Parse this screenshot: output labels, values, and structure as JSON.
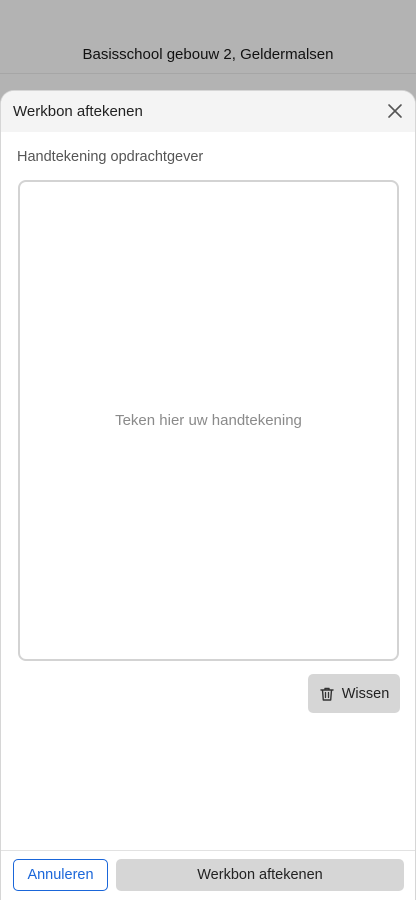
{
  "background": {
    "title": "Basisschool gebouw 2, Geldermalsen"
  },
  "dialog": {
    "title": "Werkbon aftekenen",
    "close_icon": "close-icon",
    "field_label": "Handtekening opdrachtgever",
    "signature_placeholder": "Teken hier uw handtekening",
    "clear_button": {
      "label": "Wissen",
      "icon": "trash-icon"
    }
  },
  "footer": {
    "cancel_label": "Annuleren",
    "submit_label": "Werkbon aftekenen"
  },
  "colors": {
    "accent": "#1a66d9",
    "backdrop": "#b3b3b3",
    "button_gray": "#d6d6d6"
  }
}
